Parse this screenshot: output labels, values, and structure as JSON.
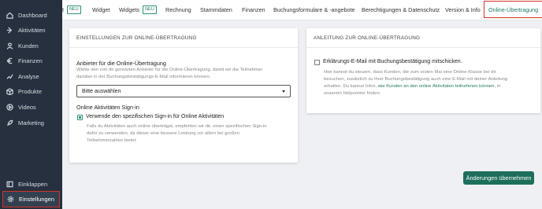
{
  "sidebar": {
    "items": [
      {
        "label": "Dashboard",
        "icon": "home-icon"
      },
      {
        "label": "Aktivitäten",
        "icon": "activity-icon"
      },
      {
        "label": "Kunden",
        "icon": "user-icon"
      },
      {
        "label": "Finanzen",
        "icon": "euro-icon"
      },
      {
        "label": "Analyse",
        "icon": "chart-icon"
      },
      {
        "label": "Produkte",
        "icon": "box-icon"
      },
      {
        "label": "Videos",
        "icon": "play-icon"
      },
      {
        "label": "Marketing",
        "icon": "rocket-icon"
      }
    ],
    "collapse_label": "Einklappen",
    "settings_label": "Einstellungen"
  },
  "topnav": {
    "tabs": [
      {
        "label": "nt",
        "badge": "NEU"
      },
      {
        "label": "Widget"
      },
      {
        "label": "Widgets",
        "badge": "NEU"
      },
      {
        "label": "Rechnung"
      },
      {
        "label": "Stammdaten"
      },
      {
        "label": "Finanzen"
      },
      {
        "label": "Buchungsformulare & -angebote"
      },
      {
        "label": "Berechtigungen & Datenschutz"
      },
      {
        "label": "Version & Info"
      },
      {
        "label": "Online-Übertragung"
      }
    ]
  },
  "settings_card": {
    "title": "EINSTELLUNGEN ZUR ONLINE-ÜBERTRAGUNG",
    "provider_label": "Anbieter für die Online-Übertragung",
    "provider_help_1": "Wähle den von dir genutzten Anbieter für die Online-Übertragung, damit wir die Teilnehmer",
    "provider_help_2": "darüber in der Buchungsbestätigungs-E-Mail informieren können.",
    "provider_select_value": "Bitte auswählen",
    "signin_label": "Online Aktivitäten Sign-in",
    "signin_checkbox_label": "Verwende den spezifischen Sign-in für Online Aktivitäten",
    "signin_help_1": "Falls du Aktivitäten auch online überträgst, empfehlen wir dir, einen spezifischen Sign-in",
    "signin_help_2": "dafür zu verwenden, da dieser eine bessere Leistung vor allem bei großen",
    "signin_help_3": "Teilnehmerzahlen bietet."
  },
  "guide_card": {
    "title": "ANLEITUNG ZUR ONLINE-ÜBERTRAGUNG",
    "checkbox_label": "Erklärungs-E-Mail mit Buchungsbestätigung mitschicken.",
    "help_1": "Hier kannst du steuern, dass Kunden, die zum ersten Mal eine Online-Klasse bei dir",
    "help_2": "besuchen, zusätzlich zu ihrer Buchungsbestätigung auch eine E-Mail mit deiner Anleitung",
    "help_3a": "erhalten. Du kannst Infos, ",
    "help_3_link": "wie Kunden an den online Aktivitäten teilnehmen können",
    "help_3b": ", in",
    "help_4": "unserem Helpcenter finden."
  },
  "apply_button": "Änderungen übernehmen",
  "colors": {
    "sidebar_bg": "#26303e",
    "accent_green": "#1e6e5c",
    "highlight_red": "#d0342c"
  }
}
